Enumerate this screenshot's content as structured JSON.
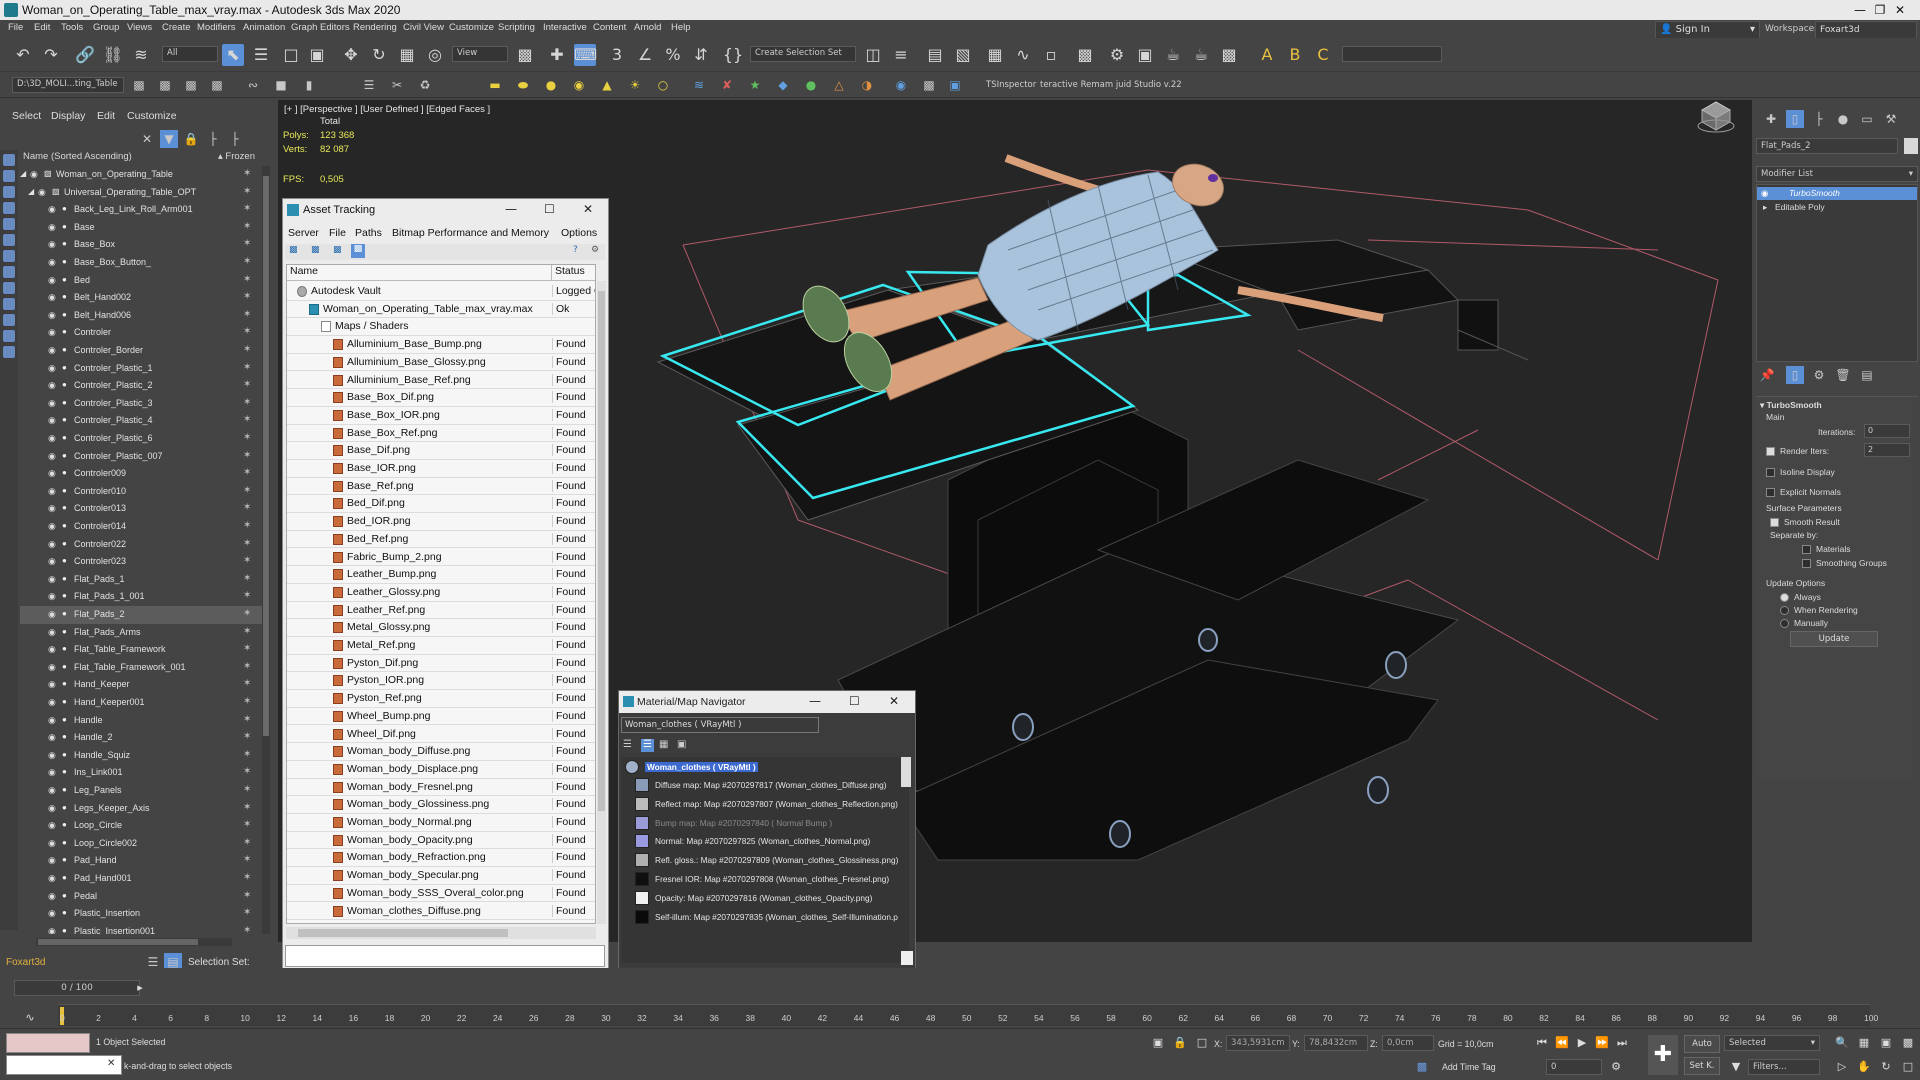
{
  "window": {
    "title": "Woman_on_Operating_Table_max_vray.max - Autodesk 3ds Max 2020"
  },
  "menu": [
    "File",
    "Edit",
    "Tools",
    "Group",
    "Views",
    "Create",
    "Modifiers",
    "Animation",
    "Graph Editors",
    "Rendering",
    "Civil View",
    "Customize",
    "Scripting",
    "Interactive",
    "Content",
    "Arnold",
    "Help"
  ],
  "account": {
    "sign_in": "Sign In",
    "workspaces_label": "Workspaces:",
    "workspace": "Foxart3d"
  },
  "toolbar": {
    "filter": "All",
    "view": "View",
    "selection_set": "Create Selection Set",
    "project_path": "D:\\3D_MOLI...ting_Table",
    "tsinspector": "TSInspector",
    "remap_label": "teractive Remam  juid Studio v.22"
  },
  "explorer": {
    "tabs": [
      "Select",
      "Display",
      "Edit",
      "Customize"
    ],
    "header_name": "Name (Sorted Ascending)",
    "header_frozen": "▴ Frozen",
    "root": "Woman_on_Operating_Table",
    "group": "Universal_Operating_Table_OPT",
    "items": [
      "Back_Leg_Link_Roll_Arm001",
      "Base",
      "Base_Box",
      "Base_Box_Button_",
      "Bed",
      "Belt_Hand002",
      "Belt_Hand006",
      "Controler",
      "Controler_Border",
      "Controler_Plastic_1",
      "Controler_Plastic_2",
      "Controler_Plastic_3",
      "Controler_Plastic_4",
      "Controler_Plastic_6",
      "Controler_Plastic_007",
      "Controler009",
      "Controler010",
      "Controler013",
      "Controler014",
      "Controler022",
      "Controler023",
      "Flat_Pads_1",
      "Flat_Pads_1_001",
      "Flat_Pads_2",
      "Flat_Pads_Arms",
      "Flat_Table_Framework",
      "Flat_Table_Framework_001",
      "Hand_Keeper",
      "Hand_Keeper001",
      "Handle",
      "Handle_2",
      "Handle_Squiz",
      "Ins_Link001",
      "Leg_Panels",
      "Legs_Keeper_Axis",
      "Loop_Circle",
      "Loop_Circle002",
      "Pad_Hand",
      "Pad_Hand001",
      "Pedal",
      "Plastic_Insertion",
      "Plastic_Insertion001"
    ],
    "selected": "Flat_Pads_2",
    "layer": "Foxart3d",
    "selection_set_label": "Selection Set:"
  },
  "viewport": {
    "label": "[+ ] [Perspective ]  [User Defined ]  [Edged Faces ]",
    "total": "Total",
    "polys_label": "Polys:",
    "polys": "123 368",
    "verts_label": "Verts:",
    "verts": "82 087",
    "fps_label": "FPS:",
    "fps": "0,505"
  },
  "asset_tracking": {
    "title": "Asset Tracking",
    "menus": [
      "Server",
      "File",
      "Paths",
      "Bitmap Performance and Memory",
      "Options"
    ],
    "col_name": "Name",
    "col_status": "Status",
    "vault": {
      "name": "Autodesk Vault",
      "status": "Logged O"
    },
    "file": {
      "name": "Woman_on_Operating_Table_max_vray.max",
      "status": "Ok"
    },
    "folder": "Maps / Shaders",
    "found_label": "Found",
    "maps": [
      "Alluminium_Base_Bump.png",
      "Alluminium_Base_Glossy.png",
      "Alluminium_Base_Ref.png",
      "Base_Box_Dif.png",
      "Base_Box_IOR.png",
      "Base_Box_Ref.png",
      "Base_Dif.png",
      "Base_IOR.png",
      "Base_Ref.png",
      "Bed_Dif.png",
      "Bed_IOR.png",
      "Bed_Ref.png",
      "Fabric_Bump_2.png",
      "Leather_Bump.png",
      "Leather_Glossy.png",
      "Leather_Ref.png",
      "Metal_Glossy.png",
      "Metal_Ref.png",
      "Pyston_Dif.png",
      "Pyston_IOR.png",
      "Pyston_Ref.png",
      "Wheel_Bump.png",
      "Wheel_Dif.png",
      "Woman_body_Diffuse.png",
      "Woman_body_Displace.png",
      "Woman_body_Fresnel.png",
      "Woman_body_Glossiness.png",
      "Woman_body_Normal.png",
      "Woman_body_Opacity.png",
      "Woman_body_Refraction.png",
      "Woman_body_Specular.png",
      "Woman_body_SSS_Overal_color.png",
      "Woman_clothes_Diffuse.png"
    ]
  },
  "material_navigator": {
    "title": "Material/Map Navigator",
    "field": "Woman_clothes  ( VRayMtl )",
    "root": "Woman_clothes  ( VRayMtl )",
    "entries": [
      {
        "text": "Diffuse map: Map #2070297817 (Woman_clothes_Diffuse.png)",
        "color": "#8a9bb8"
      },
      {
        "text": "Reflect map: Map #2070297807 (Woman_clothes_Reflection.png)",
        "color": "#bcbcbc"
      },
      {
        "text": "Bump map: Map #2070297840  ( Normal Bump )",
        "color": "#9b9bd8"
      },
      {
        "text": "Normal: Map #2070297825 (Woman_clothes_Normal.png)",
        "color": "#9a9ae0"
      },
      {
        "text": "Refl. gloss.: Map #2070297809 (Woman_clothes_Glossiness.png)",
        "color": "#b0b0b0"
      },
      {
        "text": "Fresnel IOR: Map #2070297808 (Woman_clothes_Fresnel.png)",
        "color": "#101010"
      },
      {
        "text": "Opacity: Map #2070297816 (Woman_clothes_Opacity.png)",
        "color": "#f0f0f0"
      },
      {
        "text": "Self-illum: Map #2070297835 (Woman_clothes_Self-Illumination.p",
        "color": "#0a0a0a"
      }
    ]
  },
  "command_panel": {
    "object_name": "Flat_Pads_2",
    "modifier_list": "Modifier List",
    "stack": [
      "TurboSmooth",
      "Editable Poly"
    ],
    "rollout": "TurboSmooth",
    "main": "Main",
    "iterations_label": "Iterations:",
    "iterations": "0",
    "render_iters_label": "Render Iters:",
    "render_iters": "2",
    "isoline": "Isoline Display",
    "explicit_normals": "Explicit Normals",
    "surface_params": "Surface Parameters",
    "smooth_result": "Smooth Result",
    "separate_by": "Separate by:",
    "materials": "Materials",
    "smoothing_groups": "Smoothing Groups",
    "update_options": "Update Options",
    "always": "Always",
    "when_rendering": "When Rendering",
    "manually": "Manually",
    "update_button": "Update"
  },
  "timeline": {
    "frame": "0 / 100",
    "ticks": [
      "0",
      "2",
      "4",
      "6",
      "8",
      "10",
      "12",
      "14",
      "16",
      "18",
      "20",
      "22",
      "24",
      "26",
      "28",
      "30",
      "32",
      "34",
      "36",
      "38",
      "40",
      "42",
      "44",
      "46",
      "48",
      "50",
      "52",
      "54",
      "56",
      "58",
      "60",
      "62",
      "64",
      "66",
      "68",
      "70",
      "72",
      "74",
      "76",
      "78",
      "80",
      "82",
      "84",
      "86",
      "88",
      "90",
      "92",
      "94",
      "96",
      "98",
      "100"
    ]
  },
  "status": {
    "selected": "1 Object Selected",
    "prompt": "k-and-drag to select objects",
    "x_label": "X:",
    "x": "343,5931cm",
    "y_label": "Y:",
    "y": "78,8432cm",
    "z_label": "Z:",
    "z": "0,0cm",
    "grid": "Grid = 10,0cm",
    "add_time_tag": "Add Time Tag",
    "auto": "Auto",
    "set_k": "Set K.",
    "selected_mode": "Selected",
    "filters": "Filters...",
    "frame_field": "0"
  },
  "colors": {
    "accent": "#5b8fd6",
    "wire_highlight": "#38e8f0",
    "stats": "#e8e858"
  }
}
